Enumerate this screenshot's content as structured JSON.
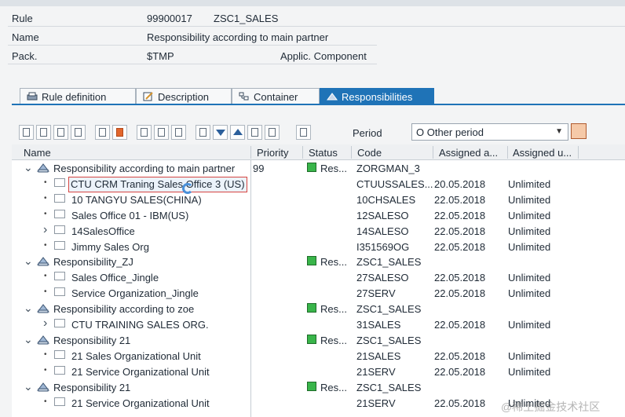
{
  "header": {
    "rule_label": "Rule",
    "rule_id": "99900017",
    "rule_name": "ZSC1_SALES",
    "name_label": "Name",
    "name_value": "Responsibility according to main partner",
    "pack_label": "Pack.",
    "pack_value": "$TMP",
    "appl_label": "Applic. Component"
  },
  "tabs": [
    {
      "label": "Rule definition"
    },
    {
      "label": "Description"
    },
    {
      "label": "Container"
    },
    {
      "label": "Responsibilities"
    }
  ],
  "toolbar": {
    "period_label": "Period",
    "period_value": "O Other period"
  },
  "columns": [
    "Name",
    "Priority",
    "Status",
    "Code",
    "Assigned a...",
    "Assigned u..."
  ],
  "rows": [
    {
      "name": "Responsibility according to main partner",
      "priority": "99",
      "status": "Res...",
      "code": "ZORGMAN_3",
      "from": "",
      "to": ""
    },
    {
      "name": "CTU CRM Traning Sales Office 3 (US)",
      "priority": "",
      "status": "",
      "code": "CTUUSSALES...",
      "from": "20.05.2018",
      "to": "Unlimited"
    },
    {
      "name": "10 TANGYU SALES(CHINA)",
      "priority": "",
      "status": "",
      "code": "10CHSALES",
      "from": "22.05.2018",
      "to": "Unlimited"
    },
    {
      "name": "Sales Office 01 - IBM(US)",
      "priority": "",
      "status": "",
      "code": "12SALESO",
      "from": "22.05.2018",
      "to": "Unlimited"
    },
    {
      "name": "14SalesOffice",
      "priority": "",
      "status": "",
      "code": "14SALESO",
      "from": "22.05.2018",
      "to": "Unlimited"
    },
    {
      "name": "Jimmy Sales Org",
      "priority": "",
      "status": "",
      "code": "I351569OG",
      "from": "22.05.2018",
      "to": "Unlimited"
    },
    {
      "name": "Responsibility_ZJ",
      "priority": "",
      "status": "Res...",
      "code": "ZSC1_SALES",
      "from": "",
      "to": ""
    },
    {
      "name": "Sales Office_Jingle",
      "priority": "",
      "status": "",
      "code": "27SALESO",
      "from": "22.05.2018",
      "to": "Unlimited"
    },
    {
      "name": "Service Organization_Jingle",
      "priority": "",
      "status": "",
      "code": "27SERV",
      "from": "22.05.2018",
      "to": "Unlimited"
    },
    {
      "name": "Responsibility according to zoe",
      "priority": "",
      "status": "Res...",
      "code": "ZSC1_SALES",
      "from": "",
      "to": ""
    },
    {
      "name": "CTU TRAINING SALES ORG.",
      "priority": "",
      "status": "",
      "code": "31SALES",
      "from": "22.05.2018",
      "to": "Unlimited"
    },
    {
      "name": "Responsibility 21",
      "priority": "",
      "status": "Res...",
      "code": "ZSC1_SALES",
      "from": "",
      "to": ""
    },
    {
      "name": "21 Sales Organizational Unit",
      "priority": "",
      "status": "",
      "code": "21SALES",
      "from": "22.05.2018",
      "to": "Unlimited"
    },
    {
      "name": "21 Service Organizational Unit",
      "priority": "",
      "status": "",
      "code": "21SERV",
      "from": "22.05.2018",
      "to": "Unlimited"
    },
    {
      "name": "Responsibility 21",
      "priority": "",
      "status": "Res...",
      "code": "ZSC1_SALES",
      "from": "",
      "to": ""
    },
    {
      "name": "21 Service Organizational Unit",
      "priority": "",
      "status": "",
      "code": "21SERV",
      "from": "22.05.2018",
      "to": "Unlimited"
    }
  ],
  "watermark": "@稀土掘金技术社区"
}
